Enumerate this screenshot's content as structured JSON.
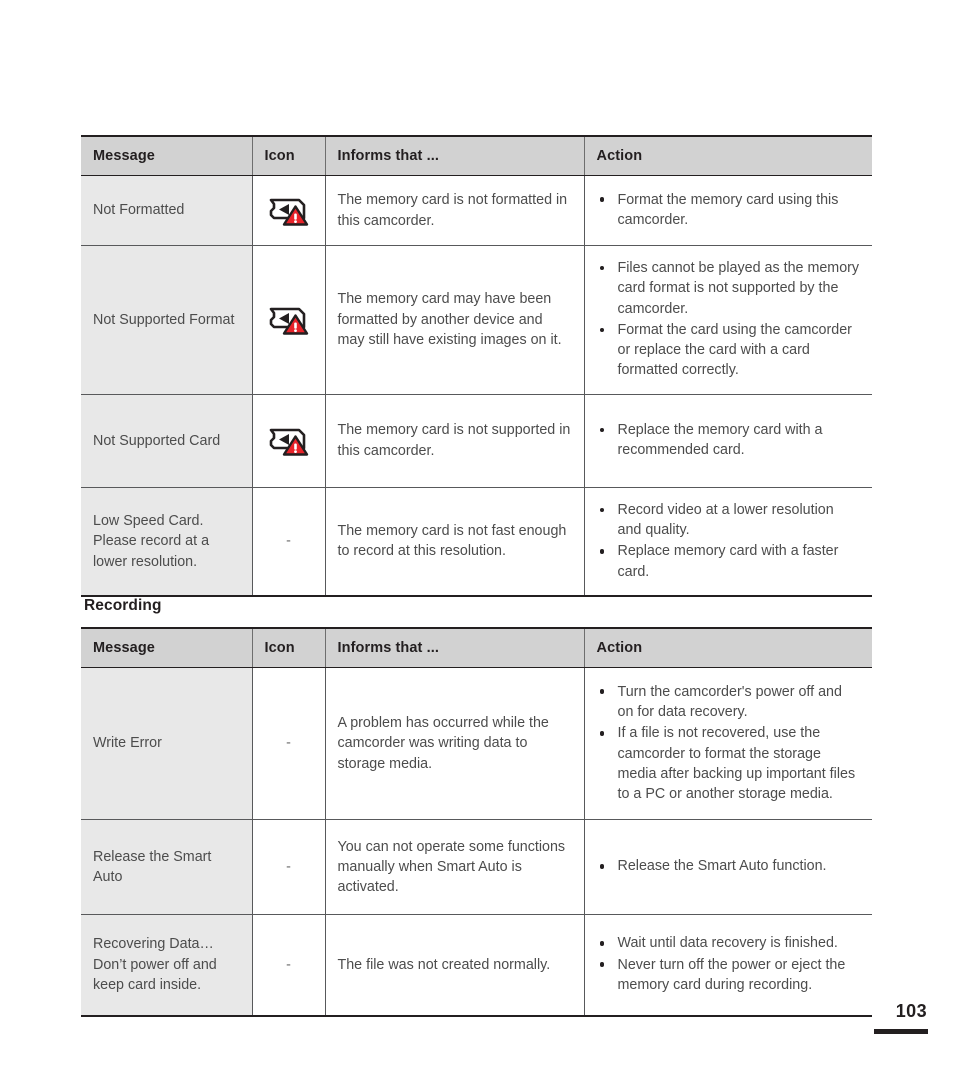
{
  "page": {
    "number": "103",
    "section_title": "Recording"
  },
  "icons": {
    "card_warning": "memory-card-warning-icon",
    "none": "-"
  },
  "tables": [
    {
      "id": "storage-media-messages",
      "headers": [
        "Message",
        "Icon",
        "Informs that ...",
        "Action"
      ],
      "rows": [
        {
          "message": "Not Formatted",
          "icon": "memory-card-warning-icon",
          "informs": "The memory card is not formatted in this camcorder.",
          "actions": [
            "Format the memory card using this camcorder."
          ]
        },
        {
          "message": "Not Supported Format",
          "icon": "memory-card-warning-icon",
          "informs": "The memory card may have been formatted by another device and may still have existing images on it.",
          "actions": [
            "Files cannot be played as the memory card format is not supported by the camcorder.",
            "Format the card using the camcorder or replace the card with a card formatted correctly."
          ]
        },
        {
          "message": "Not Supported Card",
          "icon": "memory-card-warning-icon",
          "informs": "The memory card is not supported in this camcorder.",
          "actions": [
            "Replace the memory card with a recommended card."
          ]
        },
        {
          "message": "Low Speed Card. Please record at a lower resolution.",
          "icon": "-",
          "informs": "The memory card is not fast enough to record at this resolution.",
          "actions": [
            "Record video at a lower resolution and quality.",
            "Replace memory card with a faster card."
          ]
        }
      ]
    },
    {
      "id": "recording-messages",
      "headers": [
        "Message",
        "Icon",
        "Informs that ...",
        "Action"
      ],
      "rows": [
        {
          "message": "Write Error",
          "icon": "-",
          "informs": "A problem has occurred while the camcorder was writing data to storage media.",
          "actions": [
            "Turn the camcorder's power off and on for data recovery.",
            "If a file is not recovered, use the camcorder to format the storage media after backing up important files to a PC or another storage media."
          ]
        },
        {
          "message": "Release the Smart Auto",
          "icon": "-",
          "informs": "You can not operate some functions manually when Smart Auto is activated.",
          "actions": [
            "Release the Smart Auto function."
          ]
        },
        {
          "message": "Recovering Data… Don’t power off and keep card inside.",
          "icon": "-",
          "informs": "The file was not created normally.",
          "actions": [
            "Wait until data recovery is finished.",
            "Never turn off the power or eject the memory card during recording."
          ]
        }
      ]
    }
  ],
  "colors": {
    "header_bg": "#d2d2d2",
    "message_bg": "#e8e8e8",
    "border": "#231f20",
    "text": "#4c4c4c",
    "warning_red": "#e8232a",
    "warning_outline": "#231f20"
  }
}
